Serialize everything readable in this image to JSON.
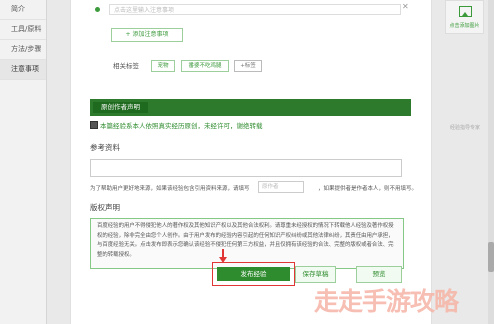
{
  "left_nav": {
    "items": [
      {
        "label": "简介"
      },
      {
        "label": "工具/原料"
      },
      {
        "label": "方法/步骤"
      },
      {
        "label": "注意事项",
        "active": true
      }
    ]
  },
  "tips": {
    "placeholder": "点击这里输入注意事项",
    "add_button": "+ 添加注意事项"
  },
  "tags": {
    "label": "相关标签",
    "items": [
      "宠物",
      "番婆不吃鸡腿",
      "+标签"
    ]
  },
  "author": {
    "button": "原创作者声明",
    "original_text": "本篇经验系本人依照真实经历原创，未经许可，谢绝转载",
    "original_checked": true
  },
  "reference": {
    "title": "参考资料",
    "note": "为了帮助用户更好地来源，如果该经验包含引用资料来源，请填写",
    "input_placeholder": "原作者",
    "note2": "，如果提供者是作者本人，则不用填写。"
  },
  "copyright": {
    "title": "版权声明",
    "text": "百度经验的用户不得侵犯他人的著作权及其他知识产权以及其他合法权利。请尊重未经授权的情况下转载他人经验及著作权授权的经验，除非完全由您个人创作。由于用户发布的经验内容引起的任何知识产权纠纷或其他法律纠纷，其责任由用户承担，与百度经验无关。点击发布即表示您确认该经验不侵犯任何第三方权益，并且仅拥有该经验的合法、完整的版权或者合法、完整的转载授权。"
  },
  "actions": {
    "publish": "发布经验",
    "save_draft": "保存草稿",
    "preview": "预览"
  },
  "right_panel": {
    "add_picture": "点击添加图片",
    "experience_label": "经验指导专家"
  },
  "watermark": "走走手游攻略",
  "colors": {
    "brand_green": "#2e8b2e",
    "highlight_red": "#e13636"
  }
}
